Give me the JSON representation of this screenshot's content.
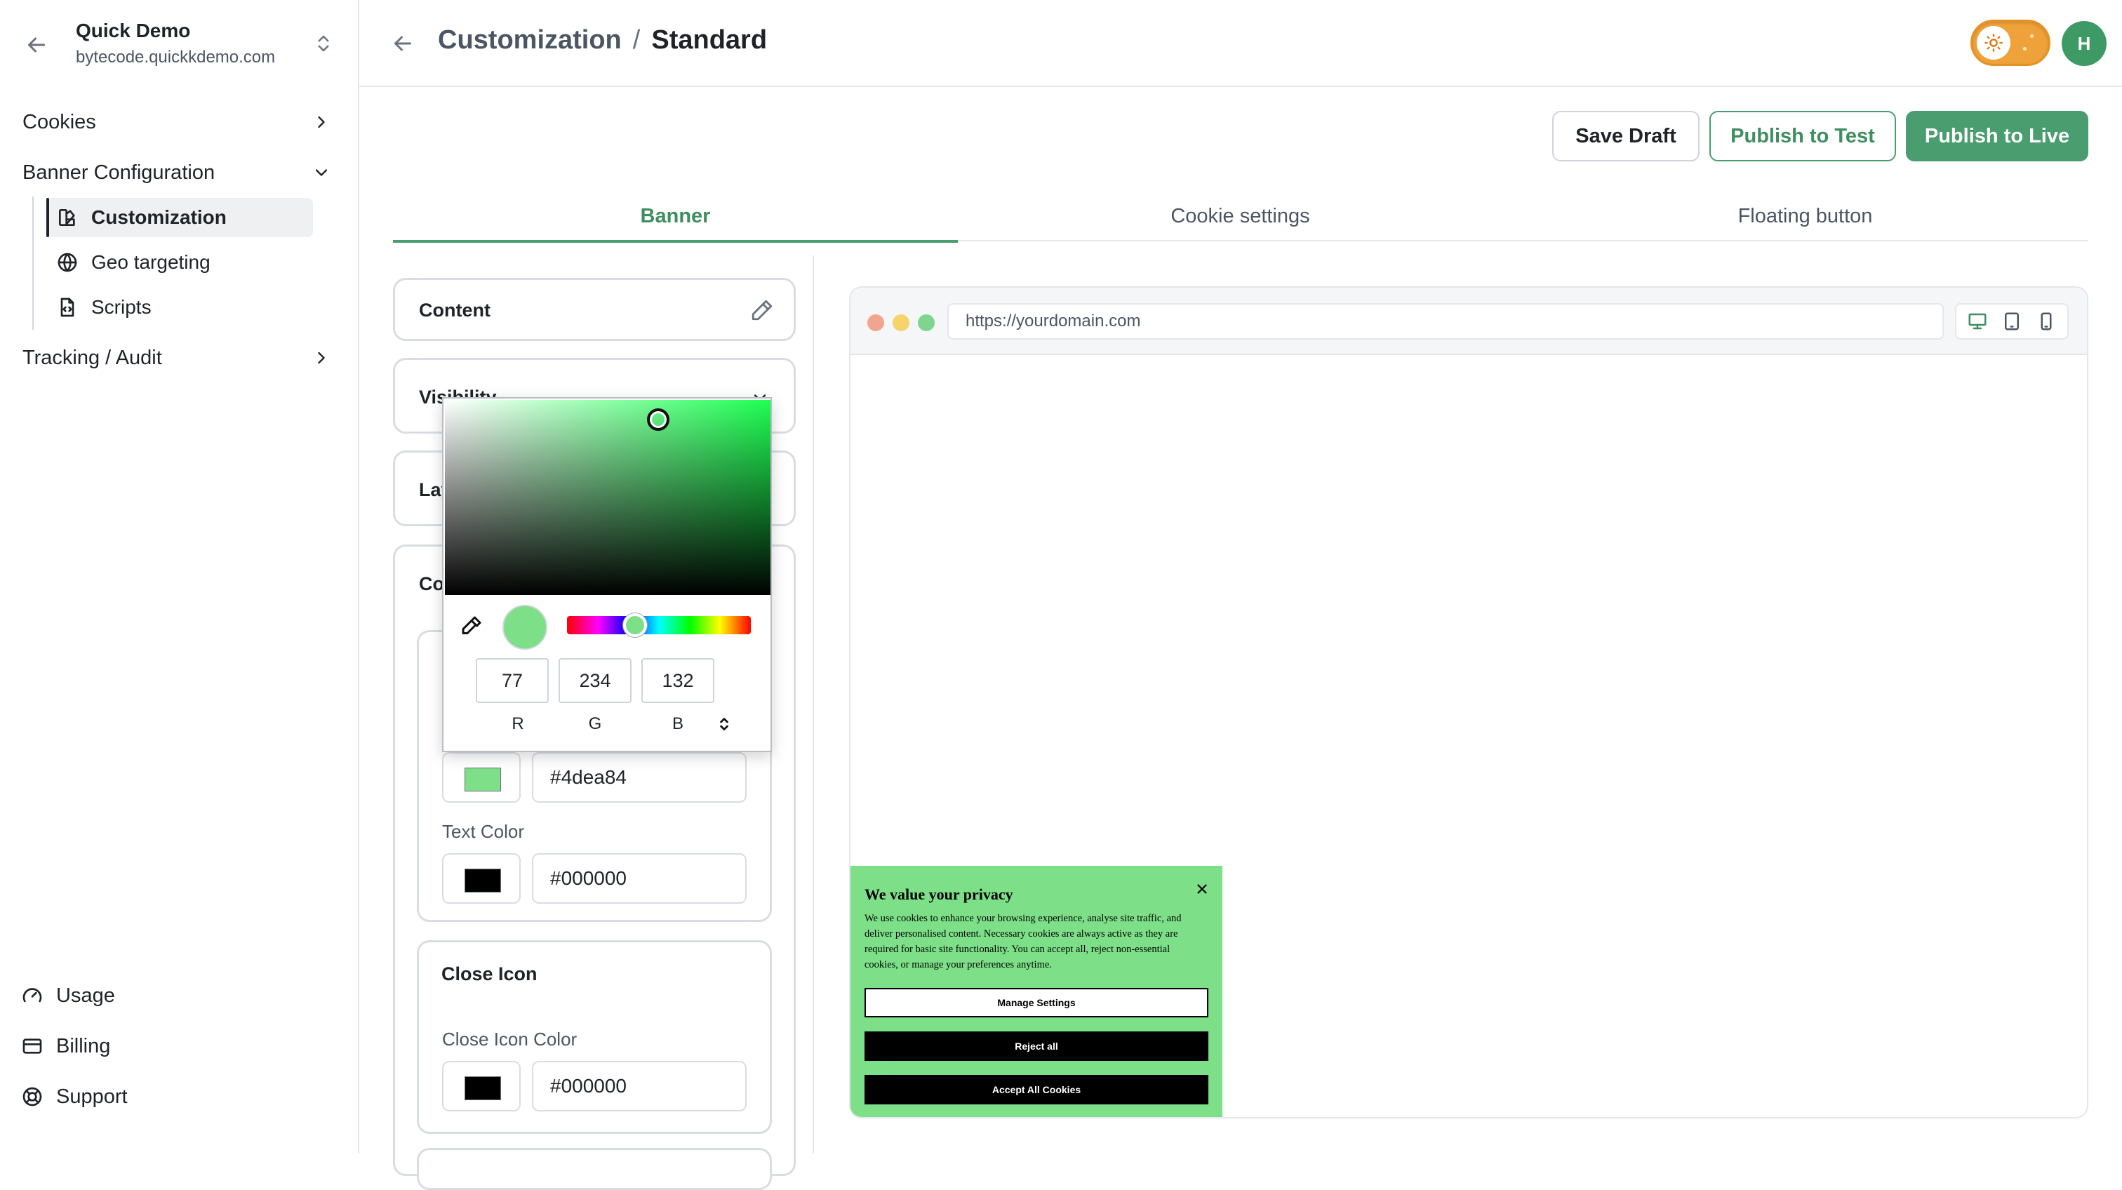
{
  "workspace": {
    "name": "Quick Demo",
    "domain": "bytecode.quickkdemo.com"
  },
  "sidebar": {
    "items": [
      {
        "label": "Cookies"
      },
      {
        "label": "Banner Configuration"
      },
      {
        "label": "Tracking / Audit"
      }
    ],
    "sub_items": [
      {
        "label": "Customization",
        "icon": "palette-icon"
      },
      {
        "label": "Geo targeting",
        "icon": "globe-icon"
      },
      {
        "label": "Scripts",
        "icon": "script-file-icon"
      }
    ],
    "bottom": [
      {
        "label": "Usage",
        "icon": "gauge-icon"
      },
      {
        "label": "Billing",
        "icon": "credit-card-icon"
      },
      {
        "label": "Support",
        "icon": "lifebuoy-icon"
      }
    ]
  },
  "header": {
    "breadcrumb_parent": "Customization",
    "breadcrumb_sep": "/",
    "breadcrumb_current": "Standard",
    "avatar_initial": "H"
  },
  "actions": {
    "save_draft": "Save Draft",
    "publish_test": "Publish to Test",
    "publish_live": "Publish to Live"
  },
  "tabs": [
    {
      "label": "Banner",
      "active": true
    },
    {
      "label": "Cookie settings",
      "active": false
    },
    {
      "label": "Floating button",
      "active": false
    }
  ],
  "panel": {
    "content_title": "Content",
    "visibility_title": "Visibility",
    "layout_title": "Layout",
    "colors_title": "Colors",
    "background_hex": "#4dea84",
    "text_color_label": "Text Color",
    "text_color_hex": "#000000",
    "close_icon_title": "Close Icon",
    "close_icon_color_label": "Close Icon Color",
    "close_icon_color_hex": "#000000"
  },
  "picker": {
    "r": "77",
    "g": "234",
    "b": "132",
    "r_label": "R",
    "g_label": "G",
    "b_label": "B",
    "hue_position": 0.37
  },
  "preview": {
    "url": "https://yourdomain.com",
    "banner": {
      "title": "We value your privacy",
      "body": "We use cookies to enhance your browsing experience, analyse site traffic, and deliver personalised content. Necessary cookies are always active as they are required for basic site functionality. You can accept all, reject non-essential cookies, or manage your preferences anytime.",
      "manage": "Manage Settings",
      "reject": "Reject all",
      "accept": "Accept All Cookies"
    }
  },
  "colors": {
    "brand": "#4a9d6e",
    "banner_bg": "#4dea84",
    "text": "#000000",
    "window_dot_red": "#f2a58e",
    "window_dot_yellow": "#f6d36b",
    "window_dot_green": "#7fd48f"
  }
}
